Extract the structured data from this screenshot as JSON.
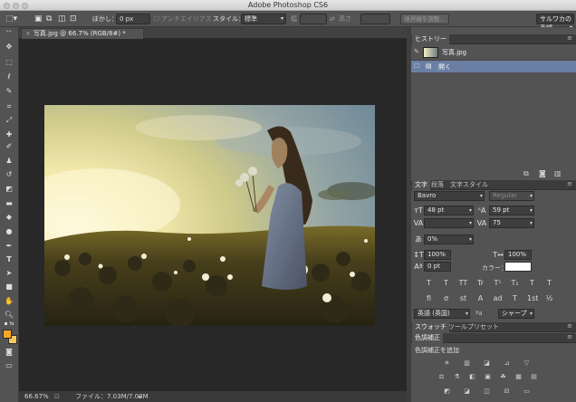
{
  "window": {
    "title": "Adobe Photoshop CS6"
  },
  "options_bar": {
    "feather_label": "ぼかし：",
    "feather_value": "0 px",
    "antialias_label": "アンチエイリアス",
    "style_label": "スタイル：",
    "style_value": "標準",
    "width_label": "幅",
    "height_label": "高さ",
    "refine_edge_button": "境界線を調整...",
    "workspace_value": "サルワカの手順"
  },
  "document": {
    "tab_label": "写真.jpg @ 66.7% (RGB/8#) *",
    "zoom": "66.67%",
    "file_info": "ファイル：7.03M/7.03M"
  },
  "colors": {
    "foreground": "#f5a623",
    "background": "#f7c85a",
    "accent_selection": "#6a7fa3"
  },
  "history_panel": {
    "tab_label": "ヒストリー",
    "snapshot_label": "写真.jpg",
    "states": [
      "開く"
    ]
  },
  "character_panel": {
    "tabs": [
      "文字",
      "段落",
      "文字スタイル"
    ],
    "font_family": "Bavro",
    "font_style": "Regular",
    "font_size": "48 pt",
    "leading": "59 pt",
    "tracking": "75",
    "baseline_percent": "0%",
    "vertical_scale": "100%",
    "horizontal_scale": "100%",
    "baseline_shift": "0 pt",
    "color_label": "カラー：",
    "language": "英語 (英国)",
    "aa_label": "ªa",
    "antialias": "シャープ",
    "style_buttons": [
      "T",
      "T",
      "TT",
      "Tr",
      "T¹",
      "T₁",
      "T",
      "T"
    ],
    "opentype_buttons": [
      "fi",
      "σ",
      "st",
      "A",
      "ad",
      "T",
      "1st",
      "½"
    ]
  },
  "swatches_panel": {
    "tabs": [
      "スウォッチ",
      "ツールプリセット"
    ]
  },
  "adjustments_panel": {
    "tab": "色調補正",
    "add_label": "色調補正を追加"
  }
}
